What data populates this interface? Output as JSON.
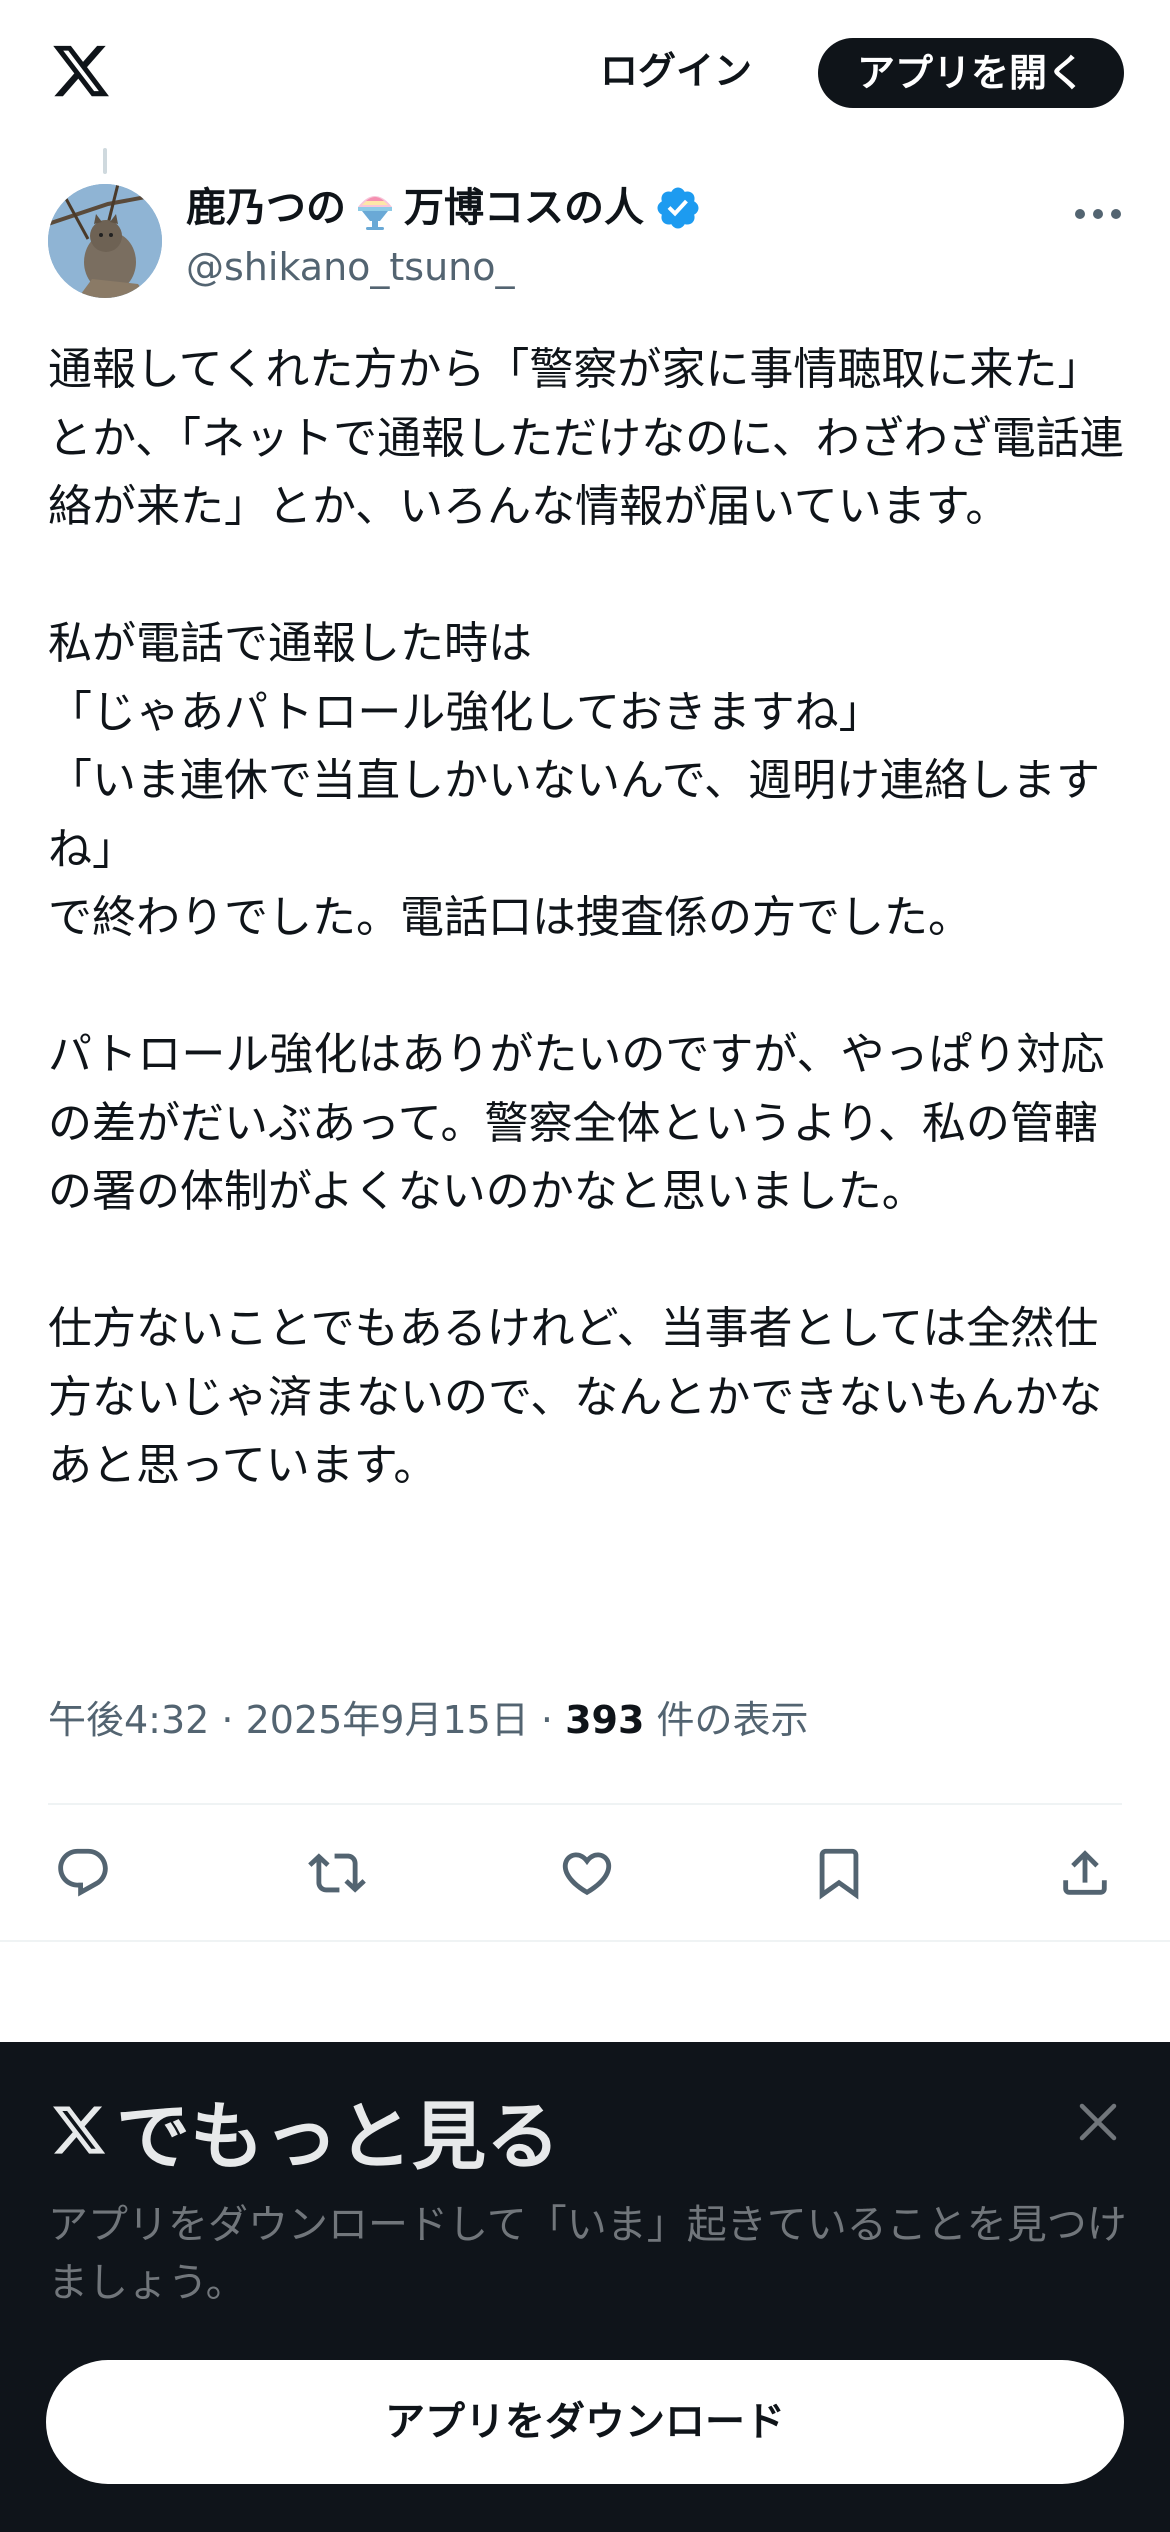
{
  "header": {
    "logo_icon": "x-logo-icon",
    "login_label": "ログイン",
    "open_app_label": "アプリを開く"
  },
  "tweet": {
    "author": {
      "name_part1": "鹿乃つの",
      "emoji_icon": "shaved-ice-icon",
      "name_part2": "万博コスの人",
      "verified_icon": "verified-badge-icon",
      "handle": "@shikano_tsuno_"
    },
    "text": "通報してくれた方から「警察が家に事情聴取に来た」とか、「ネットで通報しただけなのに、わざわざ電話連絡が来た」とか、いろんな情報が届いています。\n\n私が電話で通報した時は\n「じゃあパトロール強化しておきますね」\n「いま連休で当直しかいないんで、週明け連絡しますね」\nで終わりでした。電話口は捜査係の方でした。\n\nパトロール強化はありがたいのですが、やっぱり対応の差がだいぶあって。警察全体というより、私の管轄の署の体制がよくないのかなと思いました。\n\n仕方ないことでもあるけれど、当事者としては全然仕方ないじゃ済まないので、なんとかできないもんかなあと思っています。",
    "time": "午後4:32",
    "sep1": " · ",
    "date": "2025年9月15日",
    "sep2": " · ",
    "views_count": "393",
    "views_label": " 件の表示",
    "actions": [
      "reply-icon",
      "retweet-icon",
      "like-icon",
      "bookmark-icon",
      "share-icon"
    ]
  },
  "sheet": {
    "title": "でもっと見る",
    "description": "アプリをダウンロードして「いま」起きていることを見つけましょう。",
    "download_label": "アプリをダウンロード"
  },
  "colors": {
    "text_primary": "#0f1419",
    "text_secondary": "#536471",
    "verified_blue": "#1d9bf0",
    "sheet_bg": "#0f141a"
  }
}
